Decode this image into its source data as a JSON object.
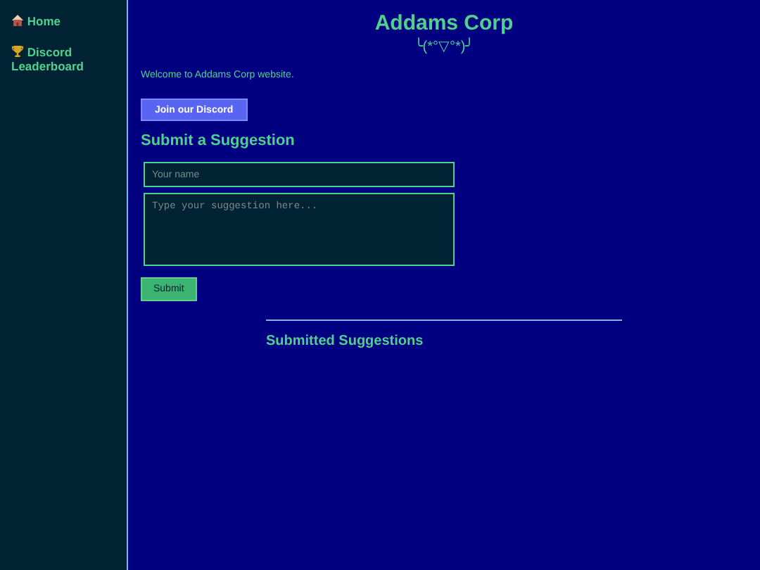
{
  "sidebar": {
    "items": [
      {
        "label": "Home"
      },
      {
        "label": "Discord Leaderboard"
      }
    ]
  },
  "header": {
    "title": "Addams Corp",
    "kaomoji": "╰(*°▽°*)╯"
  },
  "welcome": "Welcome to Addams Corp website.",
  "discord_button": "Join our Discord",
  "suggestion_form": {
    "heading": "Submit a Suggestion",
    "name_placeholder": "Your name",
    "suggestion_placeholder": "Type your suggestion here...",
    "submit": "Submit"
  },
  "submitted": {
    "heading": "Submitted Suggestions"
  }
}
